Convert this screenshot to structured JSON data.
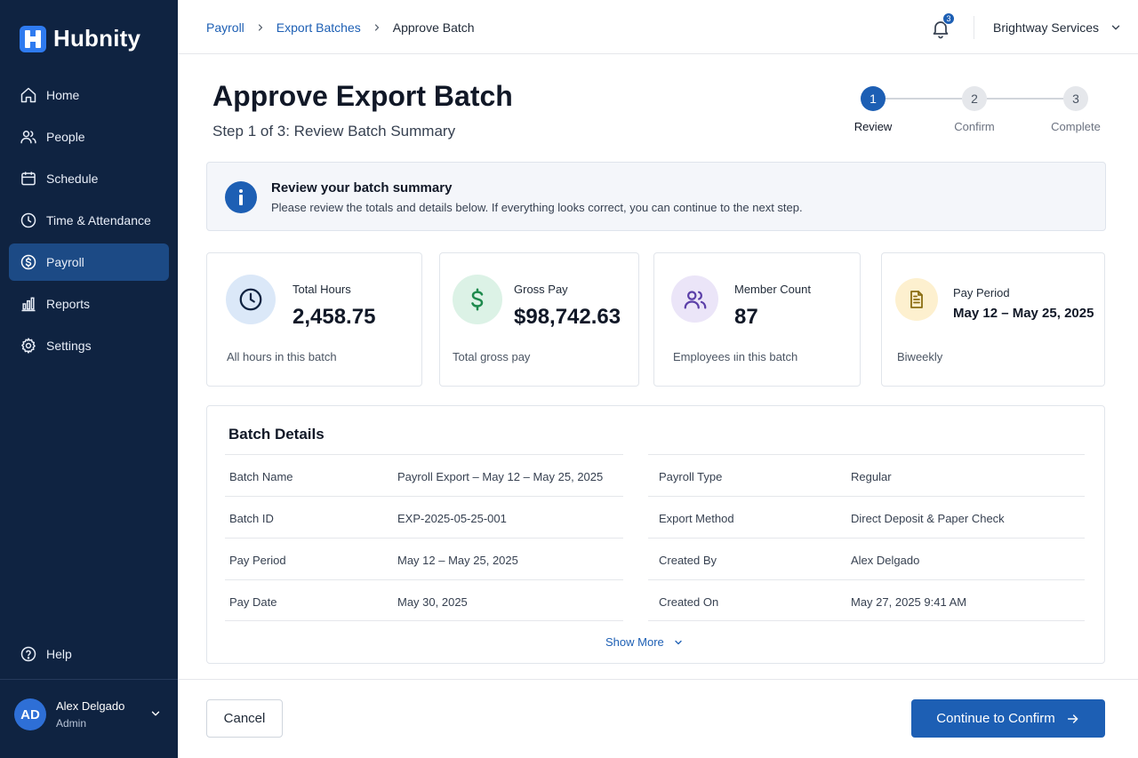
{
  "app": {
    "name": "Hubnity"
  },
  "sidebar": {
    "items": [
      {
        "label": "Home",
        "icon": "home-icon",
        "active": false
      },
      {
        "label": "People",
        "icon": "people-icon",
        "active": false
      },
      {
        "label": "Schedule",
        "icon": "calendar-icon",
        "active": false
      },
      {
        "label": "Time & Attendance",
        "icon": "clock-icon",
        "active": false
      },
      {
        "label": "Payroll",
        "icon": "dollar-icon",
        "active": true
      },
      {
        "label": "Reports",
        "icon": "bar-chart-icon",
        "active": false
      },
      {
        "label": "Settings",
        "icon": "gear-icon",
        "active": false
      }
    ],
    "help_label": "Help",
    "user": {
      "initials": "AD",
      "name": "Alex Delgado",
      "role": "Admin"
    }
  },
  "topbar": {
    "breadcrumb": [
      "Payroll",
      "Export Batches",
      "Approve Batch"
    ],
    "notification_count": "3",
    "organization": "Brightway Services"
  },
  "page": {
    "title": "Approve Export Batch",
    "subtitle": "Step 1 of 3: Review Batch Summary"
  },
  "stepper": {
    "steps": [
      {
        "number": "1",
        "label": "Review",
        "active": true
      },
      {
        "number": "2",
        "label": "Confirm",
        "active": false
      },
      {
        "number": "3",
        "label": "Complete",
        "active": false
      }
    ]
  },
  "info_banner": {
    "title": "Review your batch summary",
    "text": "Please review the totals and details below. If everything looks correct, you can continue to the next step."
  },
  "cards": [
    {
      "label": "Total Hours",
      "value": "2,458.75",
      "footer": "All hours in this batch",
      "icon": "clock-icon",
      "color": "#dbe8f8"
    },
    {
      "label": "Gross Pay",
      "value": "$98,742.63",
      "footer": "Total gross pay",
      "icon": "dollar-sign-icon",
      "color": "#dcf2e6"
    },
    {
      "label": "Member Count",
      "value": "87",
      "footer": "Employees ιin this batch",
      "icon": "users-icon",
      "color": "#ebe5f8"
    },
    {
      "label": "Pay Period",
      "value": "May 12 – May 25, 2025",
      "footer": "Biweekly",
      "icon": "document-icon",
      "color": "#fdf0cf"
    }
  ],
  "details": {
    "title": "Batch Details",
    "left": [
      {
        "key": "Batch Name",
        "value": "Payroll Export – May 12 – May 25, 2025"
      },
      {
        "key": "Batch ID",
        "value": "EXP-2025-05-25-001"
      },
      {
        "key": "Pay Period",
        "value": "May 12 – May 25, 2025"
      },
      {
        "key": "Pay Date",
        "value": "May 30, 2025"
      }
    ],
    "right": [
      {
        "key": "Payroll Type",
        "value": "Regular"
      },
      {
        "key": "Export Method",
        "value": "Direct Deposit & Paper Check"
      },
      {
        "key": "Created By",
        "value": "Alex Delgado"
      },
      {
        "key": "Created On",
        "value": "May 27, 2025 9:41 AM"
      }
    ],
    "show_more": "Show More"
  },
  "actions": {
    "cancel": "Cancel",
    "continue": "Continue to Confirm"
  },
  "colors": {
    "sidebar": "#0f2341",
    "accent": "#1d5fb4",
    "active_nav": "#1c4a85"
  }
}
